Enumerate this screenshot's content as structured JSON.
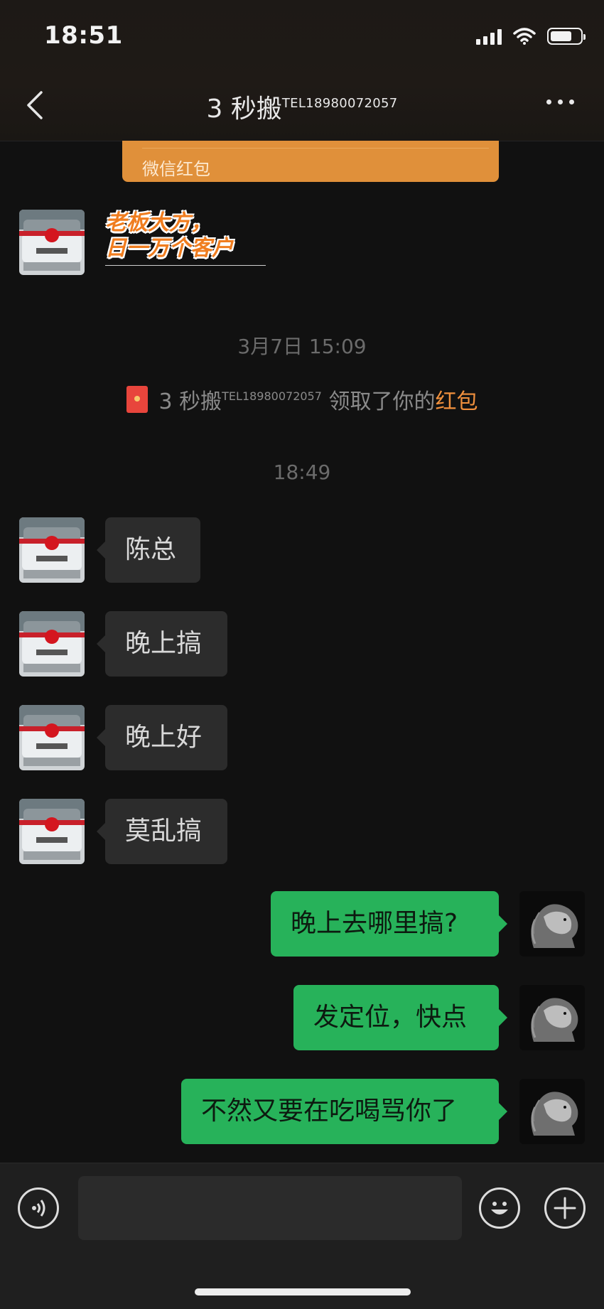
{
  "status_bar": {
    "time": "18:51",
    "battery_level": 0.72
  },
  "header": {
    "title_main": "3 秒搬",
    "title_sup": "TEL18980072057"
  },
  "red_packet_card": {
    "label": "微信红包",
    "color": "#e0903a"
  },
  "sticker": {
    "line1": "老板大方，",
    "line2": "日一万个客户"
  },
  "timestamps": [
    "3月7日 15:09",
    "18:49"
  ],
  "system_message": {
    "sender": "3 秒搬",
    "sender_sup": "TEL18980072057",
    "text": "领取了你的",
    "highlight": "红包"
  },
  "messages_in": [
    "陈总",
    "晚上搞",
    "晚上好",
    "莫乱搞"
  ],
  "messages_out": [
    "晚上去哪里搞?",
    "发定位，快点",
    "不然又要在吃喝骂你了"
  ],
  "colors": {
    "out_bubble": "#27b25a",
    "in_bubble": "#2c2c2c",
    "accent": "#f0903d"
  },
  "icons": [
    "back-chevron-icon",
    "more-icon",
    "voice-icon",
    "emoji-icon",
    "add-icon",
    "signal-icon",
    "wifi-icon",
    "battery-icon",
    "red-packet-icon"
  ]
}
